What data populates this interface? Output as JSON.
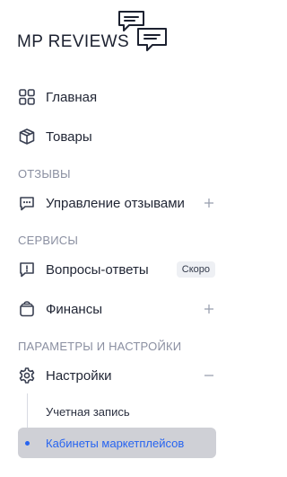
{
  "brand": {
    "name": "MP REVIEWS"
  },
  "nav": {
    "home": {
      "label": "Главная",
      "icon": "grid-icon"
    },
    "products": {
      "label": "Товары",
      "icon": "box-icon"
    }
  },
  "sections": {
    "reviews": "ОТЗЫВЫ",
    "services": "СЕРВИСЫ",
    "settings": "ПАРАМЕТРЫ И НАСТРОЙКИ"
  },
  "items": {
    "manage_reviews": {
      "label": "Управление отзывами",
      "icon": "chat-icon"
    },
    "qa": {
      "label": "Вопросы-ответы",
      "icon": "question-chat-icon",
      "badge": "Скоро"
    },
    "finance": {
      "label": "Финансы",
      "icon": "wallet-icon"
    },
    "settings": {
      "label": "Настройки",
      "icon": "gear-icon"
    }
  },
  "settings_sub": {
    "account": "Учетная запись",
    "marketplaces": "Кабинеты маркетплейсов"
  },
  "colors": {
    "accent": "#2764f0",
    "muted": "#8a8fa1",
    "active_bg": "#cfd0d6"
  }
}
